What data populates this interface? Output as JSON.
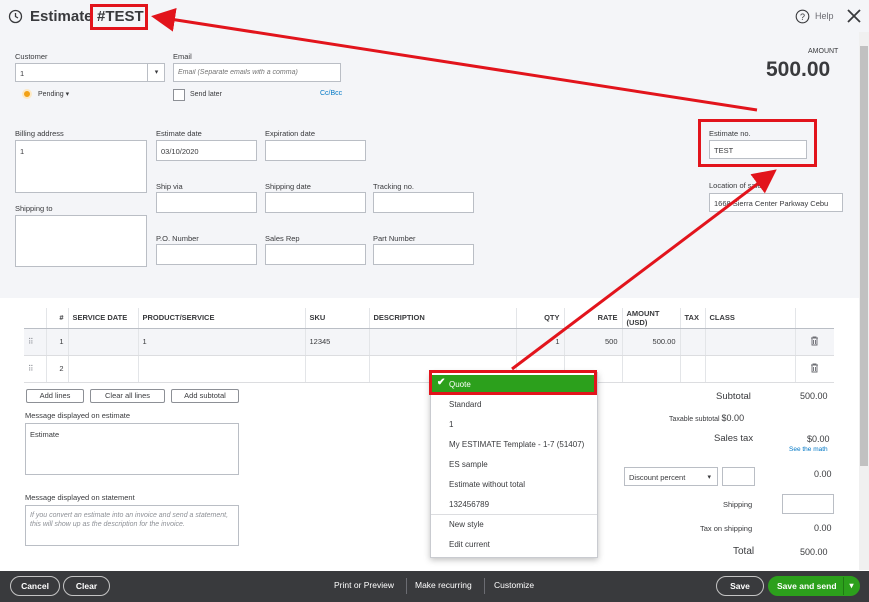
{
  "header": {
    "title": "Estimate",
    "number_tag": "#TEST",
    "help_label": "Help",
    "amount_label": "AMOUNT",
    "amount_value": "500.00"
  },
  "customer": {
    "label": "Customer",
    "value": "1",
    "status": "Pending"
  },
  "email": {
    "label": "Email",
    "placeholder": "Email (Separate emails with a comma)",
    "send_later": "Send later",
    "cc_bcc": "Cc/Bcc"
  },
  "billing": {
    "label": "Billing address",
    "value": "1"
  },
  "shipping_to": {
    "label": "Shipping to"
  },
  "fields": {
    "estimate_date_label": "Estimate date",
    "estimate_date_value": "03/10/2020",
    "expiration_date_label": "Expiration date",
    "ship_via_label": "Ship via",
    "shipping_date_label": "Shipping date",
    "tracking_label": "Tracking no.",
    "po_label": "P.O. Number",
    "sales_rep_label": "Sales Rep",
    "part_number_label": "Part Number",
    "estimate_no_label": "Estimate no.",
    "estimate_no_value": "TEST",
    "location_label": "Location of sale",
    "location_value": "1668 Sierra Center Parkway Cebu"
  },
  "table": {
    "headers": [
      "#",
      "SERVICE DATE",
      "PRODUCT/SERVICE",
      "SKU",
      "DESCRIPTION",
      "QTY",
      "RATE",
      "AMOUNT (USD)",
      "TAX",
      "CLASS"
    ],
    "rows": [
      {
        "num": "1",
        "date": "",
        "product": "1",
        "sku": "12345",
        "desc": "",
        "qty": "1",
        "rate": "500",
        "amount": "500.00",
        "tax": "",
        "class": ""
      },
      {
        "num": "2",
        "date": "",
        "product": "",
        "sku": "",
        "desc": "",
        "qty": "",
        "rate": "",
        "amount": "",
        "tax": "",
        "class": ""
      }
    ]
  },
  "line_buttons": {
    "add_lines": "Add lines",
    "clear_all": "Clear all lines",
    "add_subtotal": "Add subtotal"
  },
  "messages": {
    "estimate_label": "Message displayed on estimate",
    "estimate_value": "Estimate",
    "statement_label": "Message displayed on statement",
    "statement_placeholder": "If you convert an estimate into an invoice and send a statement, this will show up as the description for the invoice."
  },
  "dropdown": {
    "items": [
      "Quote",
      "Standard",
      "1",
      "My ESTIMATE Template - 1-7 (51407)",
      "ES sample",
      "Estimate without total",
      "132456789",
      "New style",
      "Edit current"
    ],
    "selected": "Quote"
  },
  "totals": {
    "subtotal_label": "Subtotal",
    "subtotal_value": "500.00",
    "taxable_label": "Taxable subtotal",
    "taxable_value": "$0.00",
    "sales_tax_label": "Sales tax",
    "sales_tax_value": "$0.00",
    "see_math": "See the math",
    "discount_select": "Discount percent",
    "discount_value": "0.00",
    "shipping_label": "Shipping",
    "tax_shipping_label": "Tax on shipping",
    "tax_shipping_value": "0.00",
    "total_label": "Total",
    "total_value": "500.00"
  },
  "footer": {
    "cancel": "Cancel",
    "clear": "Clear",
    "print_preview": "Print or Preview",
    "make_recurring": "Make recurring",
    "customize": "Customize",
    "save": "Save",
    "save_send": "Save and send"
  },
  "colors": {
    "highlight": "#e2141c",
    "accent_green": "#2ca01c",
    "footer_bg": "#393a3d",
    "link_blue": "#0077c5"
  }
}
